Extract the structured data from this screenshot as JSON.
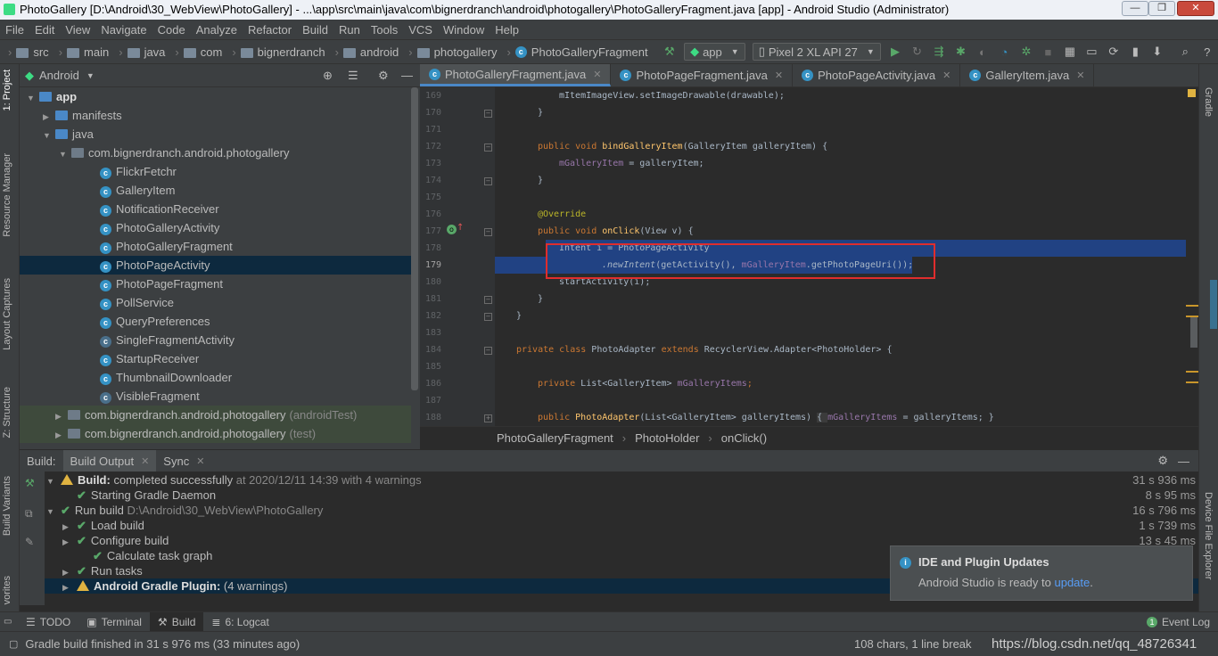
{
  "window": {
    "title": "PhotoGallery [D:\\Android\\30_WebView\\PhotoGallery] - ...\\app\\src\\main\\java\\com\\bignerdranch\\android\\photogallery\\PhotoGalleryFragment.java [app] - Android Studio (Administrator)"
  },
  "menu": [
    "File",
    "Edit",
    "View",
    "Navigate",
    "Code",
    "Analyze",
    "Refactor",
    "Build",
    "Run",
    "Tools",
    "VCS",
    "Window",
    "Help"
  ],
  "nav": {
    "crumbs": [
      "src",
      "main",
      "java",
      "com",
      "bignerdranch",
      "android",
      "photogallery",
      "PhotoGalleryFragment"
    ],
    "config": "app",
    "device": "Pixel 2 XL API 27"
  },
  "left_strip": {
    "project": "1: Project",
    "resource": "Resource Manager",
    "captures": "Layout Captures",
    "structure": "Z: Structure",
    "variants": "Build Variants",
    "favorites": "vorites"
  },
  "right_strip": {
    "gradle": "Gradle",
    "device_explorer": "Device File Explorer"
  },
  "project": {
    "view_label": "Android",
    "tree": [
      {
        "label": "app",
        "kind": "module",
        "arrow": "▼"
      },
      {
        "label": "manifests",
        "kind": "folder",
        "arrow": "▶"
      },
      {
        "label": "java",
        "kind": "folder",
        "arrow": "▼"
      },
      {
        "label": "com.bignerdranch.android.photogallery",
        "kind": "package",
        "arrow": "▼"
      },
      {
        "label": "FlickrFetchr",
        "kind": "class"
      },
      {
        "label": "GalleryItem",
        "kind": "class"
      },
      {
        "label": "NotificationReceiver",
        "kind": "class"
      },
      {
        "label": "PhotoGalleryActivity",
        "kind": "class"
      },
      {
        "label": "PhotoGalleryFragment",
        "kind": "class"
      },
      {
        "label": "PhotoPageActivity",
        "kind": "class",
        "selected": true
      },
      {
        "label": "PhotoPageFragment",
        "kind": "class"
      },
      {
        "label": "PollService",
        "kind": "class"
      },
      {
        "label": "QueryPreferences",
        "kind": "class"
      },
      {
        "label": "SingleFragmentActivity",
        "kind": "abstract"
      },
      {
        "label": "StartupReceiver",
        "kind": "class"
      },
      {
        "label": "ThumbnailDownloader",
        "kind": "class"
      },
      {
        "label": "VisibleFragment",
        "kind": "abstract"
      },
      {
        "label": "com.bignerdranch.android.photogallery",
        "kind": "package",
        "arrow": "▶",
        "suffix": "(androidTest)"
      },
      {
        "label": "com.bignerdranch.android.photogallery",
        "kind": "package",
        "arrow": "▶",
        "suffix": "(test)"
      }
    ]
  },
  "editor": {
    "tabs": [
      "PhotoGalleryFragment.java",
      "PhotoPageFragment.java",
      "PhotoPageActivity.java",
      "GalleryItem.java"
    ],
    "line_numbers": [
      "169",
      "170",
      "171",
      "172",
      "173",
      "174",
      "175",
      "176",
      "177",
      "178",
      "179",
      "180",
      "181",
      "182",
      "183",
      "184",
      "185",
      "186",
      "187",
      "188"
    ],
    "lines": {
      "l169": "mItemImageView.setImageDrawable(drawable);",
      "l170": "}",
      "l172a": "public void ",
      "l172b": "bindGalleryItem",
      "l172c": "(GalleryItem galleryItem) {",
      "l173a": "mGalleryItem",
      "l173b": " = galleryItem;",
      "l174": "}",
      "l176": "@Override",
      "l177a": "public void ",
      "l177b": "onClick",
      "l177c": "(View v) {",
      "l178": "Intent i = PhotoPageActivity",
      "l179a": ".newIntent",
      "l179b": "(getActivity(), ",
      "l179c": "mGalleryItem",
      "l179d": ".getPhotoPageUri());",
      "l180": "startActivity(i);",
      "l181": "}",
      "l182": "}",
      "l184a": "private class ",
      "l184b": "PhotoAdapter ",
      "l184c": "extends ",
      "l184d": "RecyclerView.Adapter<PhotoHolder> {",
      "l186a": "private ",
      "l186b": "List<GalleryItem> ",
      "l186c": "mGalleryItems",
      "l186d": ";",
      "l188a": "public ",
      "l188b": "PhotoAdapter",
      "l188c": "(List<GalleryItem> galleryItems) ",
      "l188d": "{ ",
      "l188e": "mGalleryItems",
      "l188f": " = galleryItems; }"
    },
    "breadcrumb": [
      "PhotoGalleryFragment",
      "PhotoHolder",
      "onClick()"
    ]
  },
  "build": {
    "tabs": [
      "Build:",
      "Build Output",
      "Sync"
    ],
    "rows": [
      {
        "text": "Build:",
        "bold": true,
        "rest": " completed successfully",
        "dim": " at 2020/12/11 14:39  with 4 warnings",
        "icon": "warn",
        "arrow": "▼",
        "indent": 0,
        "duration": "31 s 936 ms"
      },
      {
        "text": "Starting Gradle Daemon",
        "icon": "check",
        "indent": 1,
        "duration": "8 s 95 ms"
      },
      {
        "text": "Run build",
        "dim": " D:\\Android\\30_WebView\\PhotoGallery",
        "icon": "check",
        "arrow": "▼",
        "indent": 0,
        "duration": "16 s 796 ms"
      },
      {
        "text": "Load build",
        "icon": "check",
        "arrow": "▶",
        "indent": 1,
        "duration": "1 s 739 ms"
      },
      {
        "text": "Configure build",
        "icon": "check",
        "arrow": "▶",
        "indent": 1,
        "duration": "13 s 45 ms"
      },
      {
        "text": "Calculate task graph",
        "icon": "check",
        "indent": 2,
        "duration": ""
      },
      {
        "text": "Run tasks",
        "icon": "check",
        "arrow": "▶",
        "indent": 1,
        "duration": ""
      },
      {
        "text": "Android Gradle Plugin:",
        "bold": true,
        "rest": " (4 warnings)",
        "icon": "warn",
        "arrow": "▶",
        "indent": -1,
        "duration": "",
        "selected": true
      }
    ]
  },
  "notification": {
    "title": "IDE and Plugin Updates",
    "body": "Android Studio is ready to ",
    "link": "update",
    "end": "."
  },
  "bottom_tabs": [
    "TODO",
    "Terminal",
    "Build",
    "6: Logcat"
  ],
  "event_log": "Event Log",
  "event_badge": "1",
  "status": {
    "message": "Gradle build finished in 31 s 976 ms (33 minutes ago)",
    "position": "108 chars, 1 line break",
    "watermark": "https://blog.csdn.net/qq_48726341"
  }
}
